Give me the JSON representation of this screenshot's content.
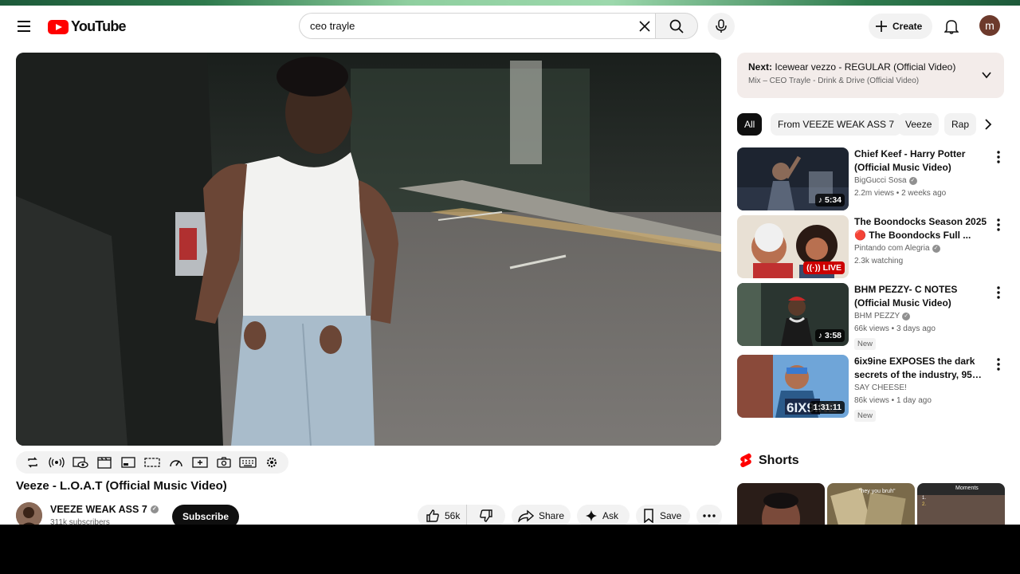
{
  "search": {
    "query": "ceo trayle",
    "placeholder": "Search"
  },
  "header": {
    "logo_text": "YouTube",
    "create_label": "Create",
    "avatar_letter": "m"
  },
  "video": {
    "title": "Veeze - L.O.A.T (Official Music Video)",
    "channel": "VEEZE WEAK ASS 7",
    "subscribers": "311k subscribers",
    "subscribe_label": "Subscribe",
    "likes": "56k",
    "share_label": "Share",
    "ask_label": "Ask",
    "save_label": "Save"
  },
  "up_next": {
    "prefix": "Next:",
    "title": "Icewear vezzo - REGULAR (Official Video)",
    "mix": "Mix – CEO Trayle - Drink & Drive (Official Video)"
  },
  "chips": [
    "All",
    "From VEEZE WEAK ASS 7",
    "Veeze",
    "Rap"
  ],
  "recommendations": [
    {
      "title": "Chief Keef -  Harry Potter (Official Music Video)",
      "channel": "BigGucci Sosa",
      "verified": true,
      "meta": "2.2m views • 2 weeks ago",
      "duration": "5:34",
      "live": false,
      "new": false,
      "colors": [
        "#1d2430",
        "#5a6578",
        "#9aa4b4"
      ]
    },
    {
      "title": "The Boondocks Season 2025 🔴 The Boondocks Full ...",
      "channel": "Pintando com Alegria",
      "verified": true,
      "meta": "2.3k watching",
      "duration": "LIVE",
      "live": true,
      "new": false,
      "colors": [
        "#e8e0d4",
        "#b87050",
        "#4a3528"
      ]
    },
    {
      "title": "BHM PEZZY- C NOTES (Official Music Video)",
      "channel": "BHM PEZZY",
      "verified": true,
      "meta": "66k views • 3 days ago",
      "duration": "3:58",
      "live": false,
      "new": true,
      "colors": [
        "#2a3530",
        "#4e5f52",
        "#c62828"
      ]
    },
    {
      "title": "6ix9ine EXPOSES the dark secrets of the industry, 95% of ...",
      "channel": "SAY CHEESE!",
      "verified": false,
      "meta": "86k views • 1 day ago",
      "duration": "1:31:11",
      "live": false,
      "new": true,
      "colors": [
        "#6fa5d8",
        "#2b5a8a",
        "#e8f0f8"
      ]
    }
  ],
  "new_badge": "New",
  "shorts": {
    "label": "Shorts",
    "items": [
      {
        "colors": [
          "#2a1d18",
          "#7a4a3a"
        ]
      },
      {
        "colors": [
          "#7a6a4a",
          "#c8b890"
        ],
        "overlay": "\"hey you bruh\""
      },
      {
        "colors": [
          "#2a2a2a",
          "#8a6a5a"
        ],
        "overlay": "Moments"
      }
    ]
  },
  "colors": {
    "accent_red": "#ff0000",
    "chip_active": "#0f0f0f",
    "upnext_bg": "#f3ecea"
  }
}
